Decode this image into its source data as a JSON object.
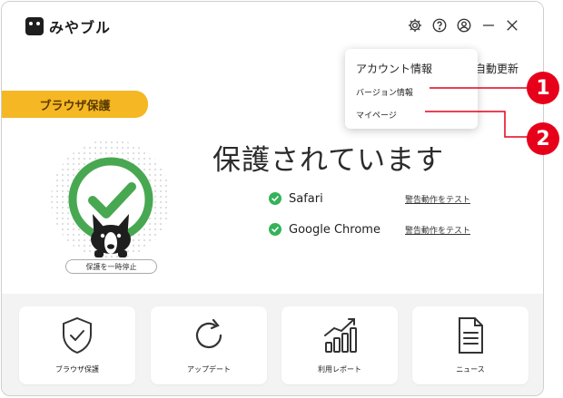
{
  "app": {
    "name": "みやブル"
  },
  "toolbar": {
    "settings_icon": "gear-icon",
    "help_icon": "help-icon",
    "account_icon": "user-circle-icon",
    "minimize_icon": "minimize-icon",
    "close_icon": "close-icon"
  },
  "header": {
    "auto_update": "自動更新"
  },
  "account_menu": {
    "title": "アカウント情報",
    "items": [
      "バージョン情報",
      "マイページ"
    ]
  },
  "protection": {
    "section_label": "ブラウザ保護",
    "status": "保護されています",
    "pause_button": "保護を一時停止",
    "browsers": [
      {
        "name": "Safari",
        "test_link": "警告動作をテスト"
      },
      {
        "name": "Google Chrome",
        "test_link": "警告動作をテスト"
      }
    ]
  },
  "tiles": [
    {
      "label": "ブラウザ保護",
      "icon": "shield-check-icon"
    },
    {
      "label": "アップデート",
      "icon": "refresh-icon"
    },
    {
      "label": "利用レポート",
      "icon": "bar-chart-icon"
    },
    {
      "label": "ニュース",
      "icon": "document-icon"
    }
  ],
  "callouts": [
    "1",
    "2"
  ],
  "colors": {
    "accent_yellow": "#f5b724",
    "check_green": "#35b25a",
    "badge_red": "#e6001a"
  }
}
